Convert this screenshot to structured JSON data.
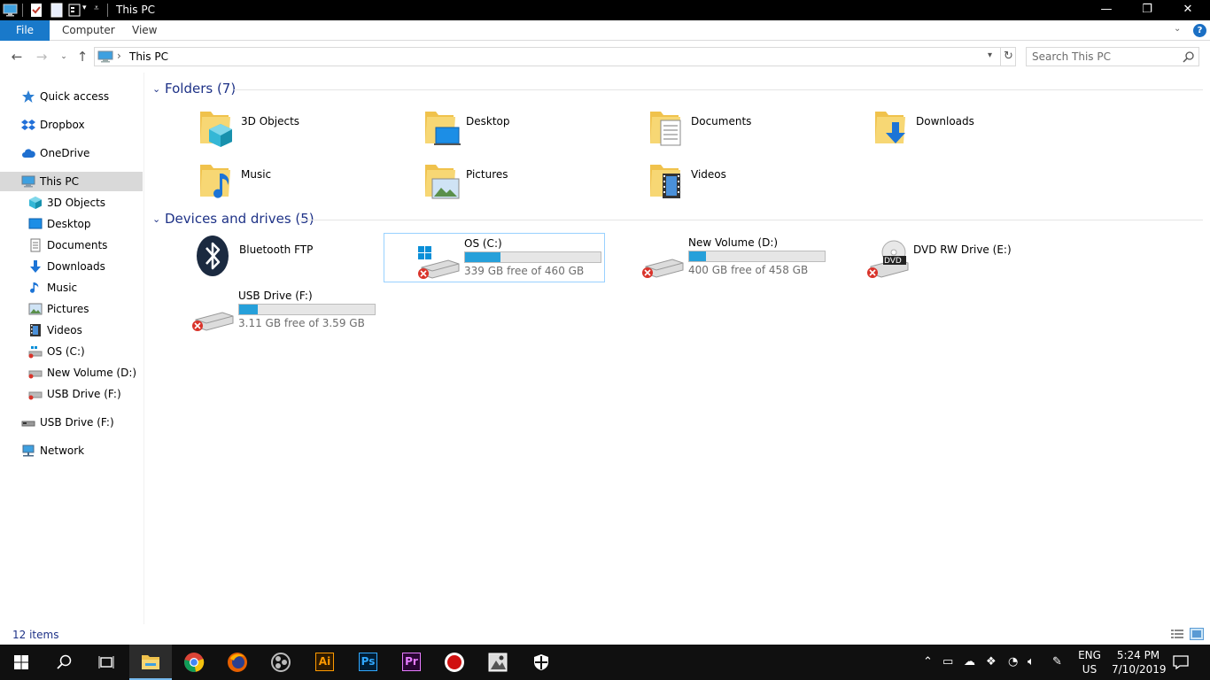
{
  "window": {
    "title": "This PC",
    "minimize": "—",
    "restore": "❐",
    "close": "✕"
  },
  "ribbon": {
    "tabs": [
      "File",
      "Computer",
      "View"
    ],
    "help": "?"
  },
  "address": {
    "path": "This PC",
    "separator": "›"
  },
  "search": {
    "placeholder": "Search This PC"
  },
  "nav_pane": {
    "items": [
      {
        "label": "Quick access",
        "icon": "star-icon"
      },
      {
        "label": "Dropbox",
        "icon": "dropbox-icon"
      },
      {
        "label": "OneDrive",
        "icon": "cloud-icon"
      },
      {
        "label": "This PC",
        "icon": "computer-icon",
        "selected": true
      },
      {
        "label": "3D Objects",
        "icon": "cube-icon"
      },
      {
        "label": "Desktop",
        "icon": "desktop-icon"
      },
      {
        "label": "Documents",
        "icon": "document-icon"
      },
      {
        "label": "Downloads",
        "icon": "download-icon"
      },
      {
        "label": "Music",
        "icon": "music-icon"
      },
      {
        "label": "Pictures",
        "icon": "pictures-icon"
      },
      {
        "label": "Videos",
        "icon": "video-icon"
      },
      {
        "label": "OS (C:)",
        "icon": "drive-icon"
      },
      {
        "label": "New Volume (D:)",
        "icon": "drive-icon"
      },
      {
        "label": "USB Drive (F:)",
        "icon": "usb-drive-icon"
      },
      {
        "label": "USB Drive (F:)",
        "icon": "usb-drive-icon"
      },
      {
        "label": "Network",
        "icon": "network-icon"
      }
    ]
  },
  "folders_group": {
    "header": "Folders (7)",
    "items": [
      {
        "label": "3D Objects",
        "icon": "cube-icon"
      },
      {
        "label": "Desktop",
        "icon": "desktop-icon"
      },
      {
        "label": "Documents",
        "icon": "document-icon"
      },
      {
        "label": "Downloads",
        "icon": "download-icon"
      },
      {
        "label": "Music",
        "icon": "music-icon"
      },
      {
        "label": "Pictures",
        "icon": "pictures-icon"
      },
      {
        "label": "Videos",
        "icon": "video-icon"
      }
    ]
  },
  "drives_group": {
    "header": "Devices and drives (5)",
    "items": [
      {
        "label": "Bluetooth FTP",
        "icon": "bluetooth-icon"
      },
      {
        "label": "OS (C:)",
        "icon": "windows-drive-icon",
        "free_text": "339 GB free of 460 GB",
        "used_fraction": 0.263
      },
      {
        "label": "New Volume (D:)",
        "icon": "drive-icon",
        "free_text": "400 GB free of 458 GB",
        "used_fraction": 0.127
      },
      {
        "label": "DVD RW Drive (E:)",
        "icon": "dvd-drive-icon",
        "badge": "DVD"
      },
      {
        "label": "USB Drive (F:)",
        "icon": "usb-drive-icon",
        "free_text": "3.11 GB free of 3.59 GB",
        "used_fraction": 0.134
      }
    ]
  },
  "status": {
    "items_count": "12 items"
  },
  "taskbar": {
    "apps": [
      "start-icon",
      "search-icon",
      "task-view-icon",
      "file-explorer-icon",
      "chrome-icon",
      "firefox-icon",
      "obs-icon",
      "illustrator-icon",
      "photoshop-icon",
      "premiere-icon",
      "record-icon",
      "image-app-icon",
      "shield-icon"
    ],
    "ai_label": "Ai",
    "ps_label": "Ps",
    "pr_label": "Pr",
    "lang_top": "ENG",
    "lang_bottom": "US",
    "time": "5:24 PM",
    "date": "7/10/2019"
  },
  "colors": {
    "accent": "#1979ca",
    "group_header": "#1e3287",
    "drive_bar": "#26a0da",
    "folder": "#f7d774",
    "selection": "#d9d9d9"
  }
}
